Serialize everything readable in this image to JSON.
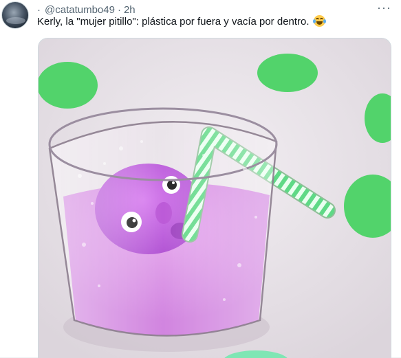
{
  "tweet": {
    "dot": "·",
    "handle": "@catatumbo49",
    "separator": "·",
    "time": "2h",
    "text": "Kerly, la \"mujer pitillo\": plástica por fuera y vacía por dentro.",
    "emoji": "face-with-tears-of-joy",
    "more_icon": "more-horizontal-icon"
  },
  "media": {
    "description_icon": "video-thumbnail",
    "colors": {
      "background": "#ebe6ec",
      "dots": "#52d36b",
      "drink": "#d98fe6",
      "face": "#c35fe0",
      "straw_green": "#6ee08a"
    }
  }
}
